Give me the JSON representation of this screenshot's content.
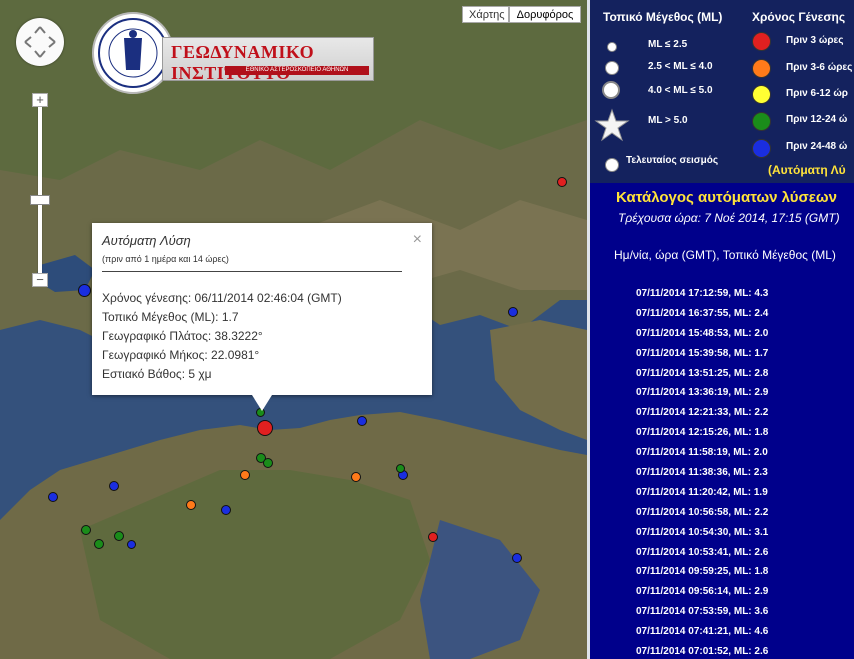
{
  "map": {
    "map_type_buttons": [
      "Χάρτης",
      "Δορυφόρος"
    ],
    "selected_map_type": "Δορυφόρος",
    "logo": {
      "title": "ΓΕΩΔΥΝΑΜΙΚΟ ΙΝΣΤΙΤΟΥΤΟ",
      "subtitle": "ΕΘΝΙΚΟ ΑΣΤΕΡΟΣΚΟΠΕΙΟ ΑΘΗΝΩΝ",
      "seal_text": "ΕΘΝΙΚΟΝ ΑΣΤΕΡΟΣΚΟΠΕΙΟΝ ΑΘΗΝΩΝ"
    },
    "zoom_plus": "+",
    "zoom_minus": "−",
    "popup": {
      "title": "Αυτόματη Λύση",
      "subtitle": "(πριν από 1 ημέρα και 14 ώρες)",
      "close": "×",
      "lines": [
        "Χρόνος γένεσης: 06/11/2014  02:46:04 (GMT)",
        "Τοπικό Μέγεθος (ML): 1.7",
        "Γεωγραφικό Πλάτος: 38.3222°",
        "Γεωγραφικό Μήκος: 22.0981°",
        "Εστιακό Βάθος: 5 χμ"
      ]
    }
  },
  "legend": {
    "magnitude_header": "Τοπικό Μέγεθος (ML)",
    "time_header": "Χρόνος Γένεσης",
    "magnitudes": [
      "ML ≤ 2.5",
      "2.5 < ML ≤ 4.0",
      "4.0 < ML ≤ 5.0",
      "ML > 5.0",
      "Τελευταίος σεισμός"
    ],
    "times": [
      {
        "label": "Πριν 3 ώρες",
        "color": "#e02020"
      },
      {
        "label": "Πριν 3-6 ώρες",
        "color": "#ff7a1a"
      },
      {
        "label": "Πριν 6-12 ώρ",
        "color": "#ffff33"
      },
      {
        "label": "Πριν 12-24 ώ",
        "color": "#1a8c1a"
      },
      {
        "label": "Πριν 24-48 ώ",
        "color": "#1a2ee0"
      }
    ],
    "footnote": "(Αυτόματη Λύ"
  },
  "catalog": {
    "title": "Κατάλογος αυτόματων λύσεων",
    "current_time": "Τρέχουσα ώρα: 7 Νοέ 2014, 17:15 (GMT)",
    "columns_header": "Ημ/νία, ώρα (GMT), Τοπικό Μέγεθος (ML)",
    "entries": [
      "07/11/2014  17:12:59,  ML: 4.3",
      "07/11/2014  16:37:55,  ML: 2.4",
      "07/11/2014  15:48:53,  ML: 2.0",
      "07/11/2014  15:39:58,  ML: 1.7",
      "07/11/2014  13:51:25,  ML: 2.8",
      "07/11/2014  13:36:19,  ML: 2.9",
      "07/11/2014  12:21:33,  ML: 2.2",
      "07/11/2014  12:15:26,  ML: 1.8",
      "07/11/2014  11:58:19,  ML: 2.0",
      "07/11/2014  11:38:36,  ML: 2.3",
      "07/11/2014  11:20:42,  ML: 1.9",
      "07/11/2014  10:56:58,  ML: 2.2",
      "07/11/2014  10:54:30,  ML: 3.1",
      "07/11/2014  10:53:41,  ML: 2.6",
      "07/11/2014  09:59:25,  ML: 1.8",
      "07/11/2014  09:56:14,  ML: 2.9",
      "07/11/2014  07:53:59,  ML: 3.6",
      "07/11/2014  07:41:21,  ML: 4.6",
      "07/11/2014  07:01:52,  ML: 2.6"
    ]
  },
  "colors": {
    "red": "#e02020",
    "orange": "#ff7a1a",
    "yellow": "#ffff33",
    "green": "#1a8c1a",
    "blue": "#1a2ee0",
    "catalog_bg": "#00008b",
    "legend_bg": "#14225e",
    "title_yellow": "#ffe33a"
  }
}
